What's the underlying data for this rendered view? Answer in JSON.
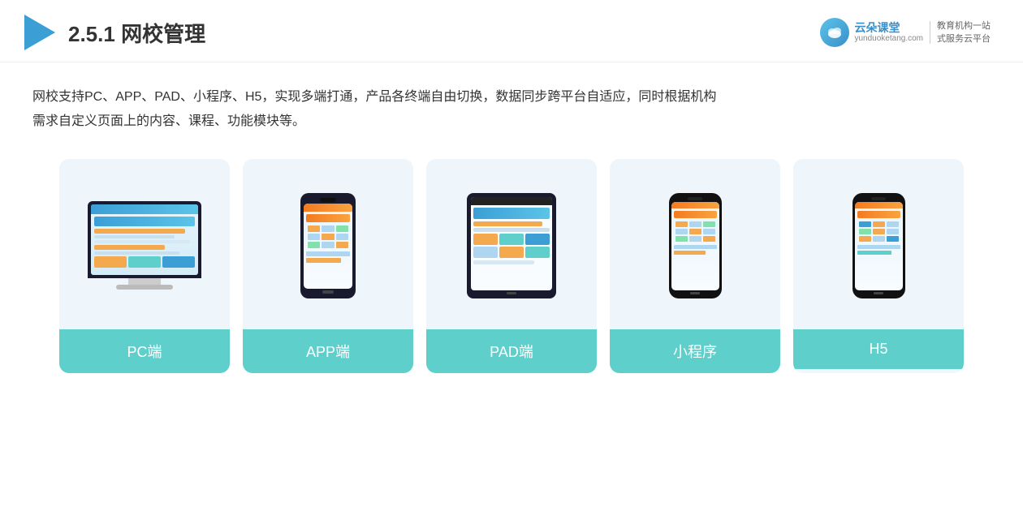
{
  "header": {
    "section_number": "2.5.1",
    "title": "网校管理",
    "brand": {
      "name": "云朵课堂",
      "domain": "yunduoketang.com",
      "slogan_line1": "教育机构一站",
      "slogan_line2": "式服务云平台"
    }
  },
  "description": {
    "line1": "网校支持PC、APP、PAD、小程序、H5，实现多端打通，产品各终端自由切换，数据同步跨平台自适应，同时根据机构",
    "line2": "需求自定义页面上的内容、课程、功能模块等。"
  },
  "devices": [
    {
      "id": "pc",
      "label": "PC端",
      "type": "pc"
    },
    {
      "id": "app",
      "label": "APP端",
      "type": "phone"
    },
    {
      "id": "pad",
      "label": "PAD端",
      "type": "pad"
    },
    {
      "id": "miniprogram",
      "label": "小程序",
      "type": "phone"
    },
    {
      "id": "h5",
      "label": "H5",
      "type": "phone"
    }
  ],
  "colors": {
    "card_label_bg": "#5ecfca",
    "card_bg": "#eef6fc",
    "accent_blue": "#3b9fd6",
    "accent_orange": "#f47b20"
  }
}
